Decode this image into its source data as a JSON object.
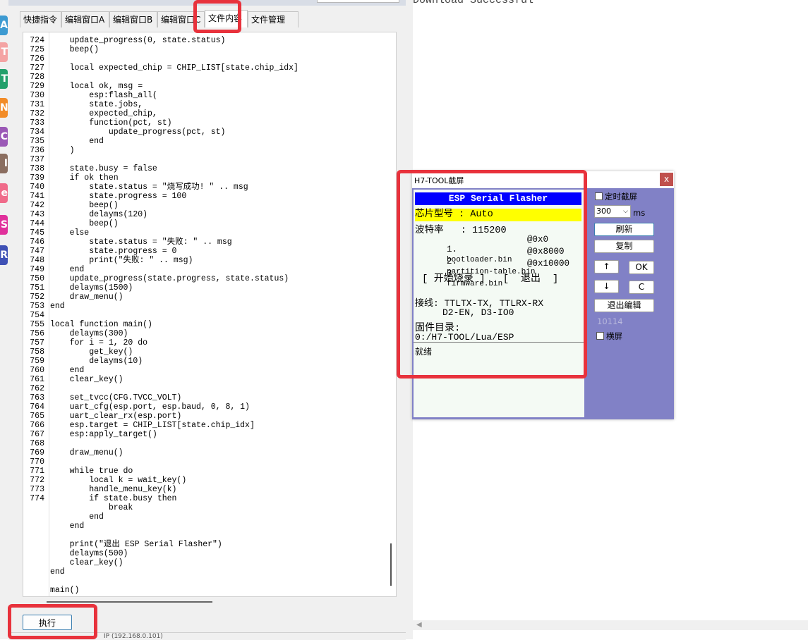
{
  "strip_badges": [
    {
      "letter": "A",
      "color": "#3d9ad1"
    },
    {
      "letter": "T",
      "color": "#f4a3a3"
    },
    {
      "letter": "T",
      "color": "#22a06b"
    },
    {
      "letter": "N",
      "color": "#f28c28"
    },
    {
      "letter": "C",
      "color": "#9b59b6"
    },
    {
      "letter": "I",
      "color": "#8b6e60"
    },
    {
      "letter": "e",
      "color": "#f06b8a"
    },
    {
      "letter": "S",
      "color": "#e0309b"
    },
    {
      "letter": "R",
      "color": "#3f51b5"
    }
  ],
  "tabs": [
    {
      "label": "快捷指令"
    },
    {
      "label": "编辑窗口A"
    },
    {
      "label": "编辑窗口B"
    },
    {
      "label": "编辑窗口C"
    },
    {
      "label": "文件内容"
    },
    {
      "label": "文件管理"
    }
  ],
  "active_tab": "文件内容",
  "line_numbers": [
    "724",
    "725",
    "726",
    "727",
    "728",
    "729",
    "730",
    "731",
    "732",
    "733",
    "734",
    "735",
    "736",
    "737",
    "738",
    "739",
    "740",
    "741",
    "742",
    "743",
    "744",
    "745",
    "746",
    "747",
    "748",
    "749",
    "750",
    "751",
    "752",
    "753",
    "754",
    "755",
    "756",
    "757",
    "758",
    "759",
    "760",
    "761",
    "762",
    "763",
    "764",
    "765",
    "766",
    "767",
    "768",
    "769",
    "770",
    "771",
    "772",
    "773",
    "774"
  ],
  "code_lines": [
    "    update_progress(0, state.status)",
    "    beep()",
    "",
    "    local expected_chip = CHIP_LIST[state.chip_idx]",
    "",
    "    local ok, msg =",
    "        esp:flash_all(",
    "        state.jobs,",
    "        expected_chip,",
    "        function(pct, st)",
    "            update_progress(pct, st)",
    "        end",
    "    )",
    "",
    "    state.busy = false",
    "    if ok then",
    "        state.status = \"烧写成功! \" .. msg",
    "        state.progress = 100",
    "        beep()",
    "        delayms(120)",
    "        beep()",
    "    else",
    "        state.status = \"失败: \" .. msg",
    "        state.progress = 0",
    "        print(\"失败: \" .. msg)",
    "    end",
    "    update_progress(state.progress, state.status)",
    "    delayms(1500)",
    "    draw_menu()",
    "end",
    "",
    "local function main()",
    "    delayms(300)",
    "    for i = 1, 20 do",
    "        get_key()",
    "        delayms(10)",
    "    end",
    "    clear_key()",
    "",
    "    set_tvcc(CFG.TVCC_VOLT)",
    "    uart_cfg(esp.port, esp.baud, 0, 8, 1)",
    "    uart_clear_rx(esp.port)",
    "    esp.target = CHIP_LIST[state.chip_idx]",
    "    esp:apply_target()",
    "",
    "    draw_menu()",
    "",
    "    while true do",
    "        local k = wait_key()",
    "        handle_menu_key(k)",
    "        if state.busy then",
    "            break",
    "        end",
    "    end",
    "",
    "    print(\"退出 ESP Serial Flasher\")",
    "    delayms(500)",
    "    clear_key()",
    "end",
    "",
    "main()"
  ],
  "exec_button": "执行",
  "status_bar": "IP (192.168.0.101)",
  "output": {
    "text": "Download Successful"
  },
  "dialog": {
    "title": "H7-TOOL截屏",
    "close_label": "x",
    "screen": {
      "header": "ESP Serial Flasher",
      "chip": "芯片型号 : Auto",
      "baud": "波特率   : 115200",
      "files": [
        {
          "num": "1.",
          "name": "bootloader.bin",
          "addr": "@0x0"
        },
        {
          "num": "2.",
          "name": "partition-table.bin",
          "addr": "@0x8000"
        },
        {
          "num": "3.",
          "name": "firmware.bin",
          "addr": "@0x10000"
        }
      ],
      "menu": "[ 开始烧录 ]   [  退出  ]",
      "wiring_1": "接线: TTLTX-TX, TTLRX-RX",
      "wiring_2": "     D2-EN, D3-IO0",
      "dir_label": "固件目录:",
      "dir_path": "0:/H7-TOOL/Lua/ESP",
      "status": "就绪"
    },
    "controls": {
      "timed_capture": "定时截屏",
      "interval_value": "300",
      "interval_unit": "ms",
      "refresh": "刷新",
      "copy": "复制",
      "up": "↑",
      "ok": "OK",
      "down": "↓",
      "c": "C",
      "exit_edit": "退出编辑",
      "counter": "10114",
      "landscape": "横屏"
    }
  },
  "highlight_color": "#e8323c"
}
